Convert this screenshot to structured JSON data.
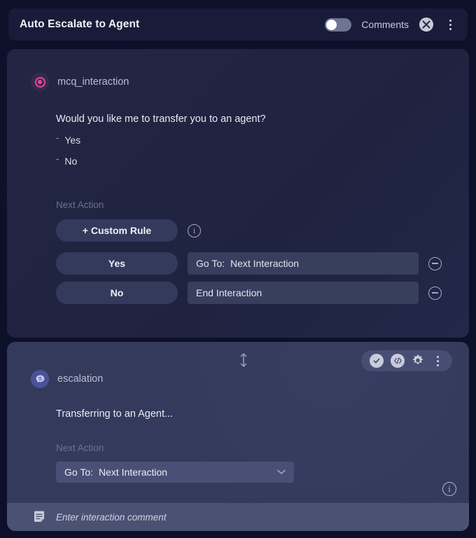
{
  "header": {
    "title": "Auto Escalate to Agent",
    "comments_label": "Comments",
    "toggle_state": "off",
    "close_icon": "close-circle-icon",
    "menu_icon": "kebab-menu-icon"
  },
  "colors": {
    "page_bg": "#0c1028",
    "header_bg": "#191c38",
    "card1_bg": "#222640",
    "card2_bg": "#343a5c",
    "accent_pink": "#e8479a",
    "accent_blue": "#4a5398",
    "toolbar_bg": "#474e74",
    "comment_bar_bg": "#4b5173",
    "muted_text": "#6d7292"
  },
  "node_mcq": {
    "icon": "radio-button-icon",
    "name": "mcq_interaction",
    "prompt": "Would you like me to transfer you to an agent?",
    "choices": [
      "Yes",
      "No"
    ],
    "next_action_label": "Next Action",
    "custom_rule_button": "+ Custom Rule",
    "info_icon": "info-icon",
    "rules": [
      {
        "key": "Yes",
        "value_label": "Go To:",
        "value": "Next Interaction",
        "remove_icon": "minus-circle-icon"
      },
      {
        "key": "No",
        "value_label": "",
        "value": "End Interaction",
        "remove_icon": "minus-circle-icon"
      }
    ]
  },
  "node_escalation": {
    "icon": "chat-transfer-icon",
    "name": "escalation",
    "message": "Transferring to an Agent...",
    "next_action_label": "Next Action",
    "goto_label": "Go To:",
    "goto_value": "Next Interaction",
    "toolbar": {
      "validate_icon": "check-circle-icon",
      "code_icon": "code-brackets-icon",
      "settings_icon": "gear-icon",
      "menu_icon": "kebab-menu-icon"
    },
    "resize_icon": "vertical-resize-arrows-icon",
    "info_icon": "info-icon"
  },
  "comment_bar": {
    "icon": "note-icon",
    "placeholder": "Enter interaction comment"
  }
}
